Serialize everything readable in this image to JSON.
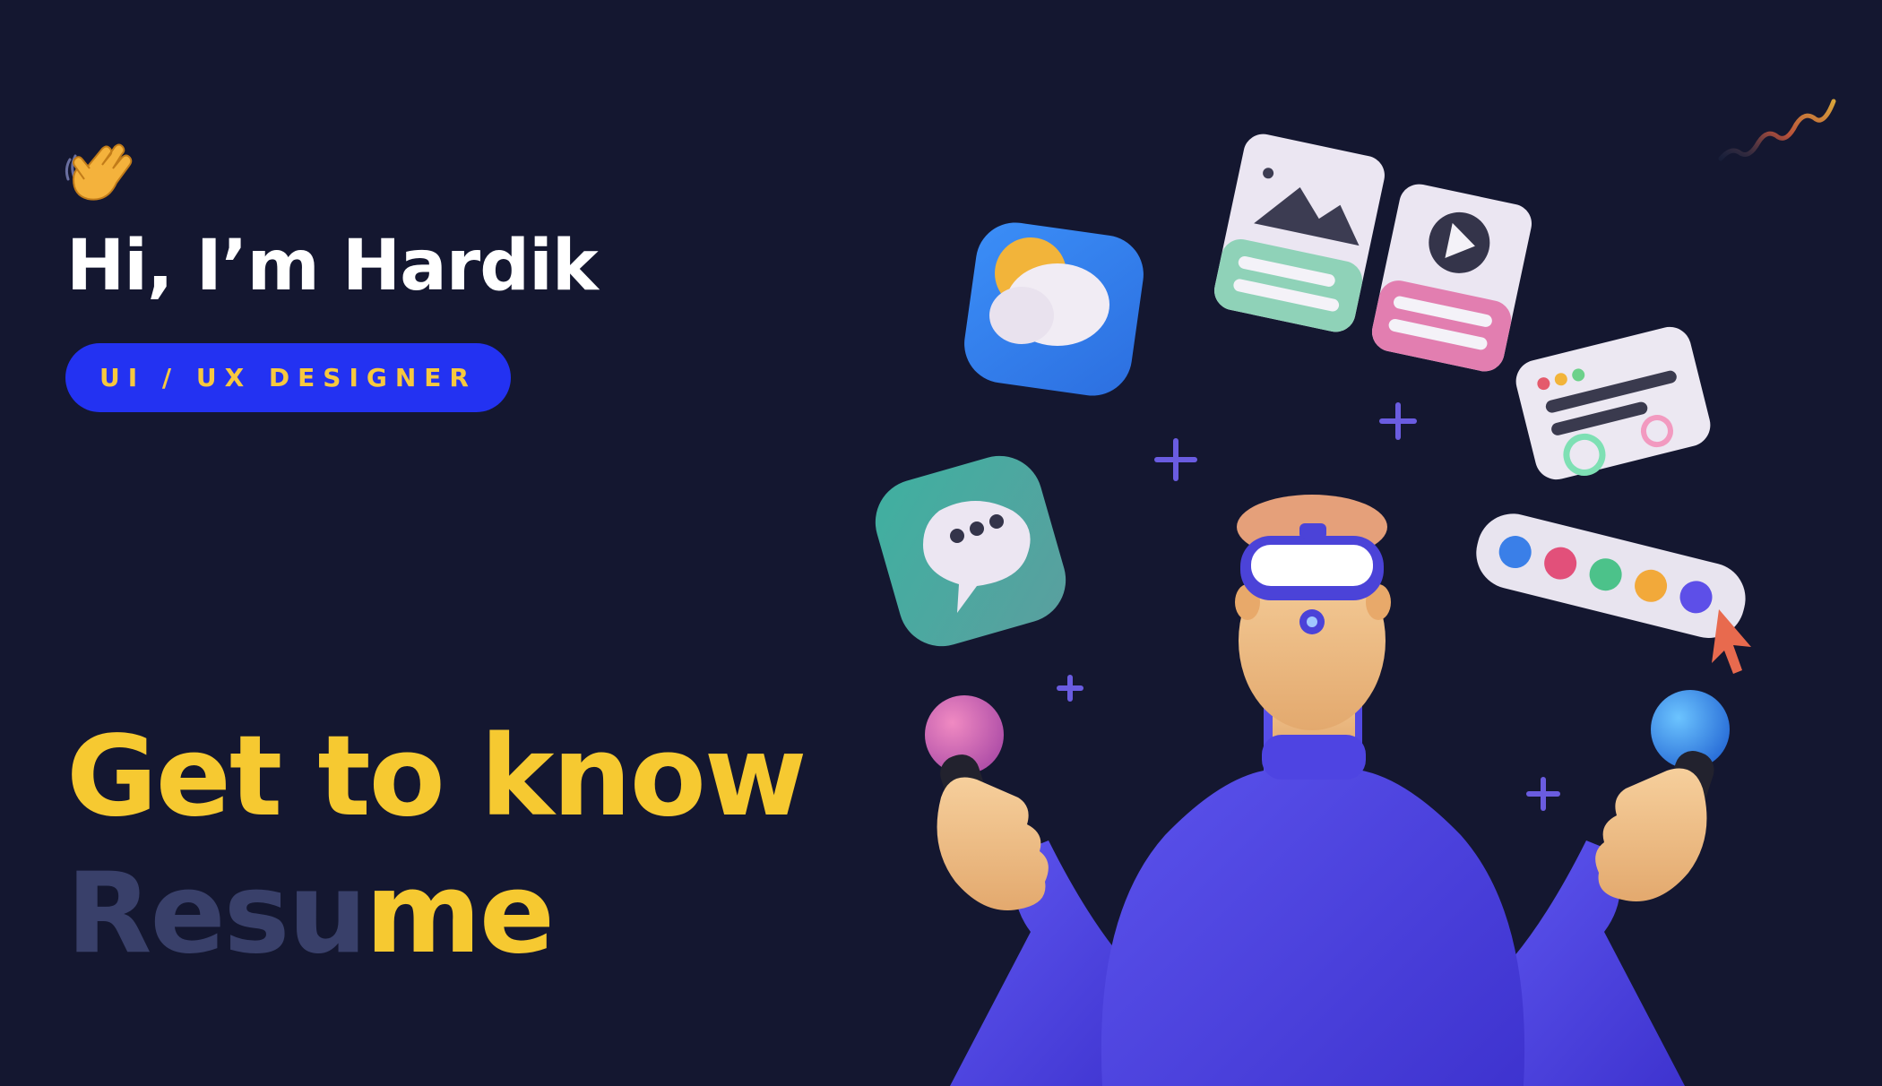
{
  "hero": {
    "greeting": "Hi, I’m Hardik",
    "role": "UI / UX DESIGNER",
    "headline": "Get to know",
    "resume_dim": "Resu",
    "resume_lit": "me"
  },
  "colors": {
    "background": "#141730",
    "accent_yellow": "#f6c931",
    "pill_blue": "#2332f2",
    "character_purple": "#5248e6",
    "dim_text": "#39406a"
  },
  "icons": [
    "waving-hand-icon",
    "weather-app-icon",
    "image-card-icon",
    "video-card-icon",
    "text-window-icon",
    "chat-bubble-icon",
    "color-palette-icon",
    "cursor-icon"
  ]
}
